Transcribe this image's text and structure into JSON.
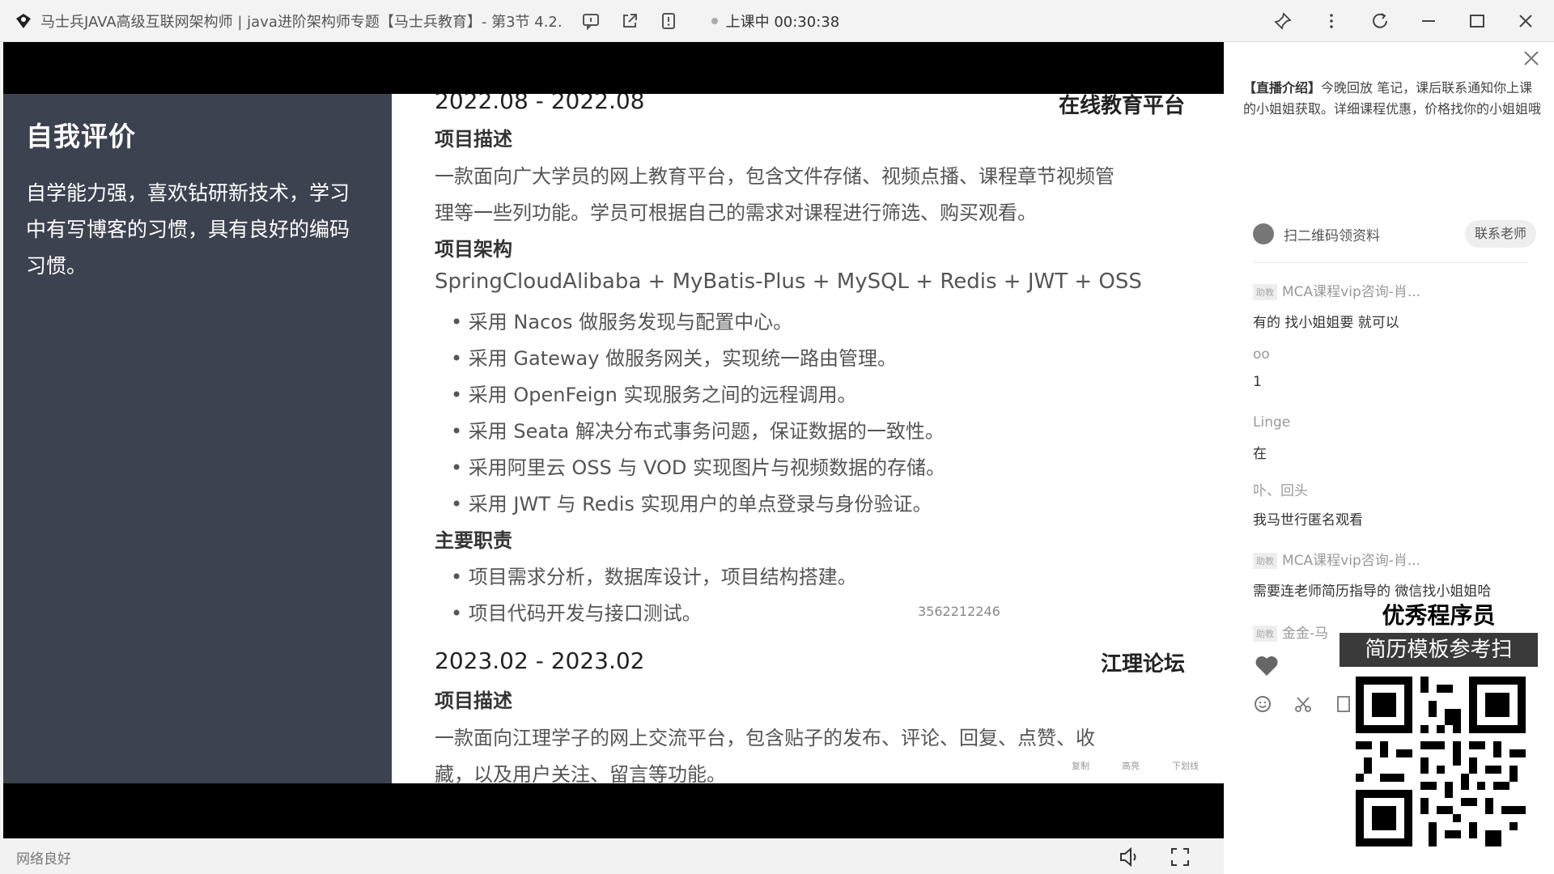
{
  "window": {
    "title": "马士兵JAVA高级互联网架构师 | java进阶架构师专题【马士兵教育】- 第3节 4.2.",
    "live_status": "上课中 00:30:38"
  },
  "resume": {
    "left": {
      "title": "自我评价",
      "text": "自学能力强，喜欢钻研新技术，学习中有写博客的习惯，具有良好的编码习惯。"
    },
    "project1": {
      "date": "2022.08 - 2022.08",
      "org": "在线教育平台",
      "desc_head": "项目描述",
      "desc_line1": "一款面向广大学员的网上教育平台，包含文件存储、视频点播、课程章节视频管",
      "desc_line2": "理等一些列功能。学员可根据自己的需求对课程进行筛选、购买观看。",
      "arch_head": "项目架构",
      "arch_stack": "SpringCloudAlibaba + MyBatis-Plus + MySQL + Redis  + JWT + OSS",
      "arch_items": [
        "• 采用 Nacos 做服务发现与配置中心。",
        "• 采用 Gateway 做服务网关，实现统一路由管理。",
        "• 采用 OpenFeign 实现服务之间的远程调用。",
        "• 采用 Seata 解决分布式事务问题，保证数据的一致性。",
        "• 采用阿里云 OSS 与 VOD 实现图片与视频数据的存储。",
        "• 采用 JWT 与 Redis 实现用户的单点登录与身份验证。"
      ],
      "duty_head": "主要职责",
      "duty_items": [
        "• 项目需求分析，数据库设计，项目结构搭建。",
        "• 项目代码开发与接口测试。"
      ],
      "watermark": "3562212246"
    },
    "project2": {
      "date": "2023.02 - 2023.02",
      "org": "江理论坛",
      "desc_head": "项目描述",
      "desc_line1": "一款面向江理学子的网上交流平台，包含贴子的发布、评论、回复、点赞、收",
      "desc_line2": "藏，以及用户关注、留言等功能。"
    },
    "tiny_tools": [
      "复制",
      "高亮",
      "下划线"
    ]
  },
  "video_bar": {
    "network": "网络良好"
  },
  "panel": {
    "intro_label": "【直播介绍】",
    "intro_text": "今晚回放 笔记，课后联系通知你上课的小姐姐获取。详细课程优惠，价格找你的小姐姐哦",
    "qr_text": "扫二维码领资料",
    "contact_button": "联系老师",
    "messages": [
      {
        "badge": "助教",
        "name": "MCA课程vip咨询-肖...",
        "text": "有的 找小姐姐要 就可以"
      },
      {
        "badge": "",
        "name": "oo",
        "text": "1"
      },
      {
        "badge": "",
        "name": "Linge",
        "text": "在"
      },
      {
        "badge": "",
        "name": "卟、回头",
        "text": "我马世行匿名观看"
      },
      {
        "badge": "助教",
        "name": "MCA课程vip咨询-肖...",
        "text": "需要连老师简历指导的 微信找小姐姐哈"
      },
      {
        "badge": "助教",
        "name": "金金-马",
        "text": ""
      }
    ]
  },
  "ad": {
    "line1": "优秀程序员",
    "line2": "简历模板参考扫"
  }
}
